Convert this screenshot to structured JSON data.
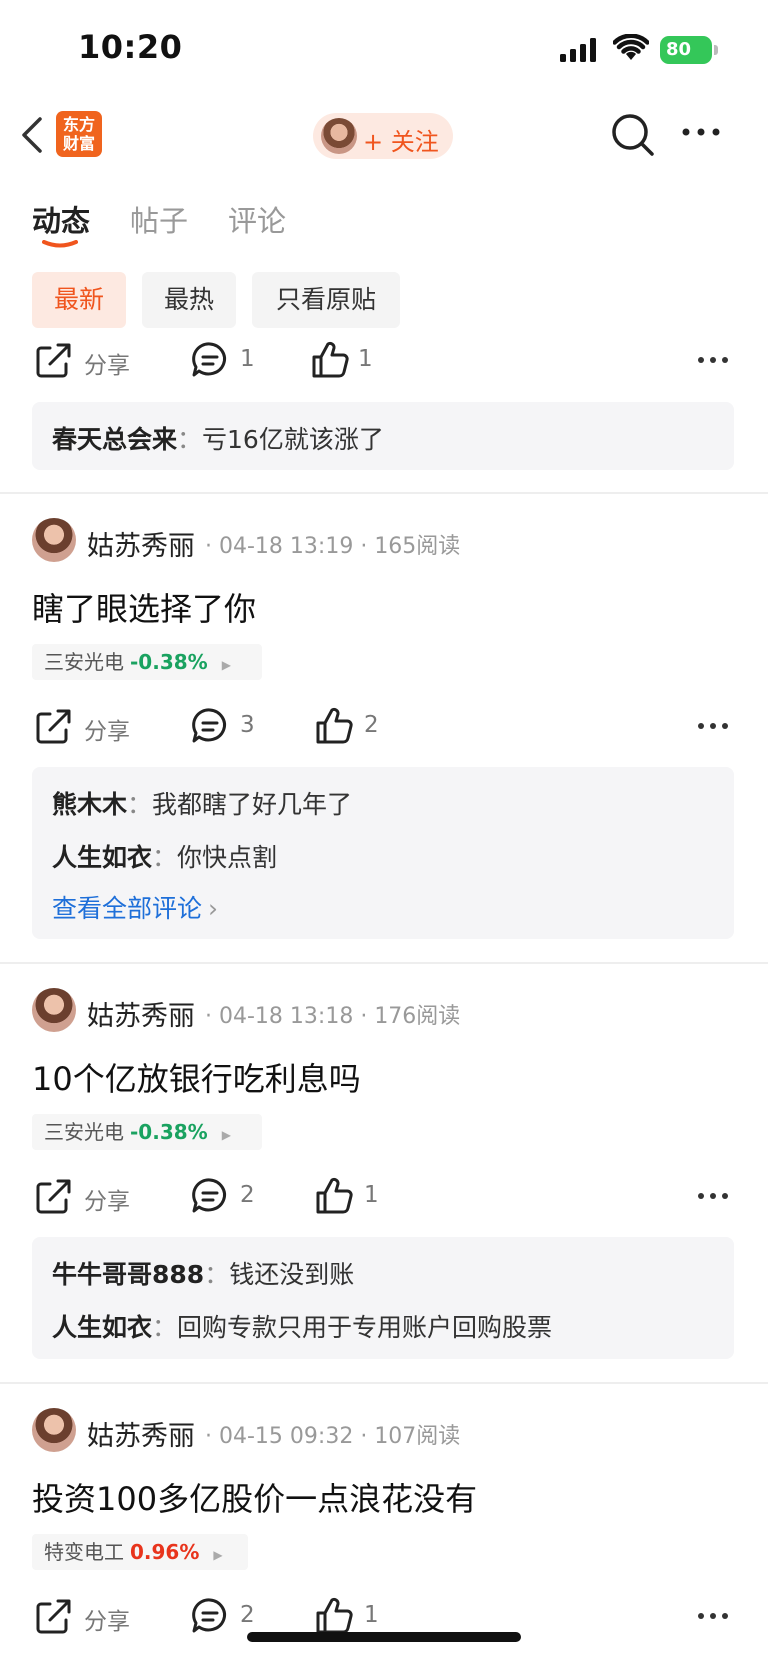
{
  "status": {
    "time": "10:20",
    "battery": "80"
  },
  "header": {
    "logo_line1": "东方",
    "logo_line2": "财富",
    "follow_label": "+ 关注"
  },
  "tabs": [
    "动态",
    "帖子",
    "评论"
  ],
  "filters": [
    "最新",
    "最热",
    "只看原贴"
  ],
  "top_actions": {
    "share": "分享",
    "comments": "1",
    "likes": "1"
  },
  "top_comment": {
    "user": "春天总会来",
    "text": "亏16亿就该涨了"
  },
  "posts": [
    {
      "user": "姑苏秀丽",
      "time": "04-18 13:19",
      "reads": "165阅读",
      "title": "瞎了眼选择了你",
      "stock": {
        "name": "三安光电",
        "pct": "-0.38%",
        "color": "#1aa260"
      },
      "actions": {
        "share": "分享",
        "comments": "3",
        "likes": "2"
      },
      "comments": [
        {
          "user": "熊木木",
          "text": "我都瞎了好几年了"
        },
        {
          "user": "人生如衣",
          "text": "你快点割"
        }
      ],
      "view_all": "查看全部评论"
    },
    {
      "user": "姑苏秀丽",
      "time": "04-18 13:18",
      "reads": "176阅读",
      "title": "10个亿放银行吃利息吗",
      "stock": {
        "name": "三安光电",
        "pct": "-0.38%",
        "color": "#1aa260"
      },
      "actions": {
        "share": "分享",
        "comments": "2",
        "likes": "1"
      },
      "comments": [
        {
          "user": "牛牛哥哥888",
          "text": "钱还没到账"
        },
        {
          "user": "人生如衣",
          "text": "回购专款只用于专用账户回购股票"
        }
      ]
    },
    {
      "user": "姑苏秀丽",
      "time": "04-15 09:32",
      "reads": "107阅读",
      "title": "投资100多亿股价一点浪花没有",
      "stock": {
        "name": "特变电工",
        "pct": "0.96%",
        "color": "#e8341c"
      },
      "actions": {
        "share": "分享",
        "comments": "2",
        "likes": "1"
      }
    }
  ],
  "colors": {
    "accent": "#f0551e",
    "link": "#1e6fd9",
    "down": "#1aa260",
    "up": "#e8341c"
  },
  "icons": [
    "back-icon",
    "search-icon",
    "more-icon",
    "share-icon",
    "comment-icon",
    "like-icon",
    "chevron-right-icon"
  ]
}
